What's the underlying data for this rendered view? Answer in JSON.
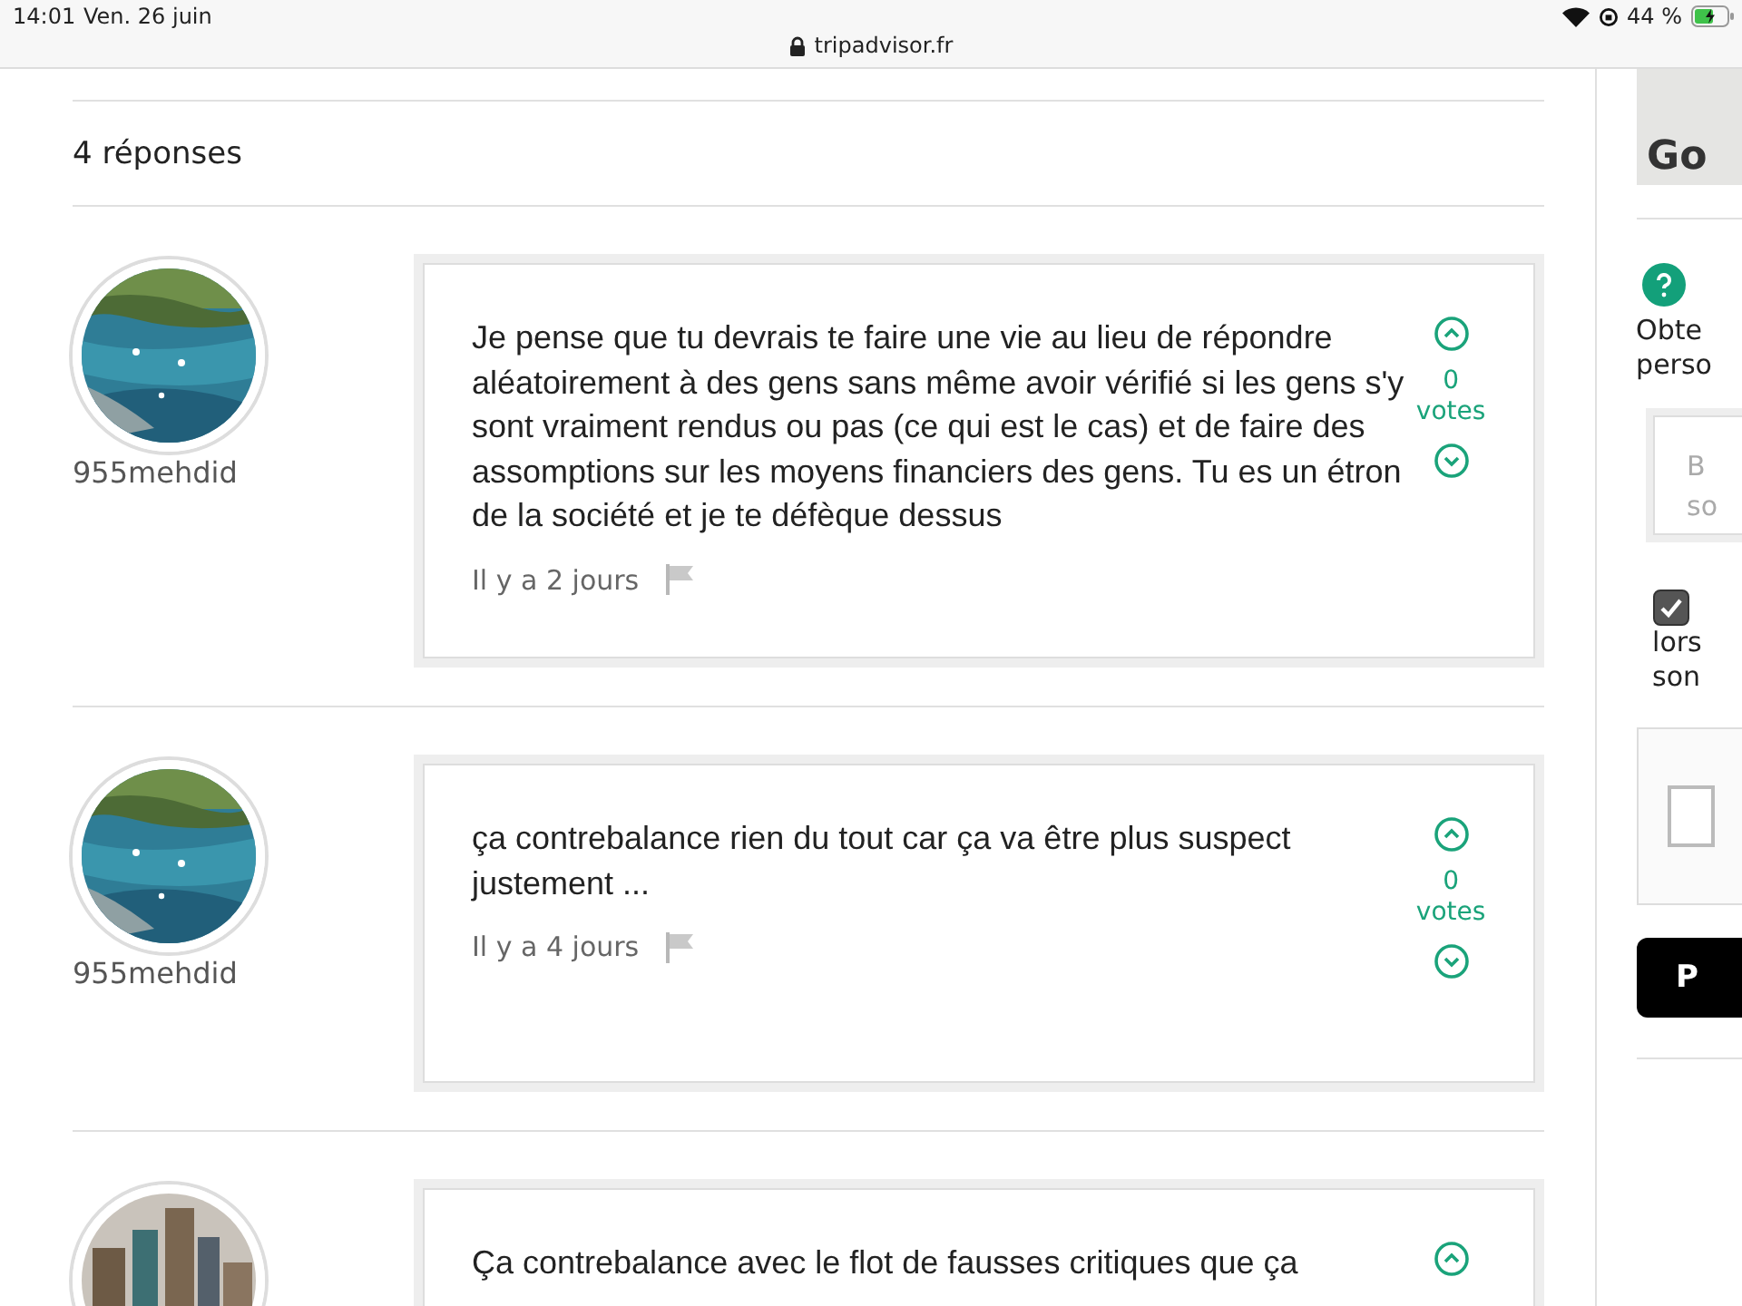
{
  "status_bar": {
    "time": "14:01",
    "date": "Ven. 26 juin",
    "url": "tripadvisor.fr",
    "battery": "44 %"
  },
  "replies_count": "4 réponses",
  "answers": [
    {
      "username": "955mehdid",
      "text": "Je pense que tu devrais te faire une vie au lieu de répondre aléatoirement à des gens sans même avoir vérifié si les gens s'y sont vraiment rendus ou pas (ce qui est le cas) et de faire des assomptions sur les moyens financiers des gens. Tu es un étron de la société et je te défèque dessus",
      "time": "Il y a 2 jours",
      "votes_count": "0",
      "votes_label": "votes"
    },
    {
      "username": "955mehdid",
      "text": "ça contrebalance rien du tout car ça va être plus suspect justement ...",
      "time": "Il y a 4 jours",
      "votes_count": "0",
      "votes_label": "votes"
    },
    {
      "text": "Ça contrebalance avec le flot de fausses critiques que ça"
    }
  ],
  "sidebar": {
    "map_label": "Go",
    "help_text": [
      "Obte",
      "perso"
    ],
    "field_placeholder": [
      "B",
      "so"
    ],
    "checkbox": {
      "checked": true
    },
    "checkbox_text": [
      "lors",
      "son"
    ],
    "captcha": {
      "checked": false
    },
    "button": "P"
  }
}
